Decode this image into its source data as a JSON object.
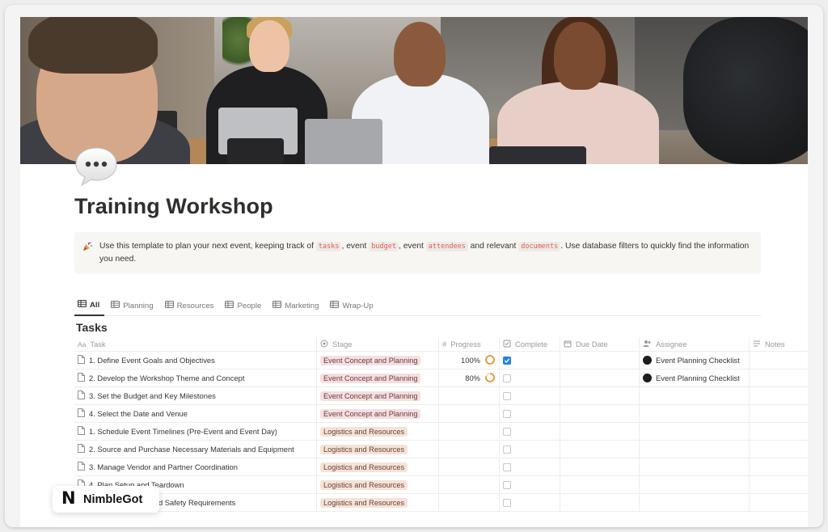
{
  "page": {
    "title": "Training Workshop"
  },
  "callout": {
    "before_tasks": "Use this template to plan your next event, keeping track of ",
    "tasks": "tasks",
    "between_1": ", event ",
    "budget": "budget",
    "between_2": ", event ",
    "attendees": "attendees",
    "between_3": " and relevant ",
    "documents": "documents",
    "after": ". Use database filters to quickly find the information you need."
  },
  "tabs": [
    {
      "label": "All",
      "active": true
    },
    {
      "label": "Planning"
    },
    {
      "label": "Resources"
    },
    {
      "label": "People"
    },
    {
      "label": "Marketing"
    },
    {
      "label": "Wrap-Up"
    }
  ],
  "database": {
    "title": "Tasks",
    "headers": {
      "task_icon": "Aa",
      "task": "Task",
      "stage": "Stage",
      "progress_icon": "#",
      "progress": "Progress",
      "complete": "Complete",
      "due": "Due Date",
      "assignee": "Assignee",
      "notes": "Notes"
    },
    "rows": [
      {
        "task": "1. Define Event Goals and Objectives",
        "stage": "Event Concept and Planning",
        "stage_color": "pink",
        "progress": "100%",
        "progress_value": 1.0,
        "complete": true,
        "assignee": "Event Planning Checklist"
      },
      {
        "task": "2. Develop the Workshop Theme and Concept",
        "stage": "Event Concept and Planning",
        "stage_color": "pink",
        "progress": "80%",
        "progress_value": 0.8,
        "complete": false,
        "assignee": "Event Planning Checklist"
      },
      {
        "task": "3. Set the Budget and Key Milestones",
        "stage": "Event Concept and Planning",
        "stage_color": "pink",
        "progress": "",
        "complete": false,
        "assignee": ""
      },
      {
        "task": "4. Select the Date and Venue",
        "stage": "Event Concept and Planning",
        "stage_color": "pink",
        "progress": "",
        "complete": false,
        "assignee": ""
      },
      {
        "task": "1. Schedule Event Timelines (Pre-Event and Event Day)",
        "stage": "Logistics and Resources",
        "stage_color": "peach",
        "progress": "",
        "complete": false,
        "assignee": ""
      },
      {
        "task": "2. Source and Purchase Necessary Materials and Equipment",
        "stage": "Logistics and Resources",
        "stage_color": "peach",
        "progress": "",
        "complete": false,
        "assignee": ""
      },
      {
        "task": "3. Manage Vendor and Partner Coordination",
        "stage": "Logistics and Resources",
        "stage_color": "peach",
        "progress": "",
        "complete": false,
        "assignee": ""
      },
      {
        "task": "4. Plan Setup and Teardown",
        "stage": "Logistics and Resources",
        "stage_color": "peach",
        "progress": "",
        "complete": false,
        "assignee": ""
      },
      {
        "task": "5. Confirm Health and Safety Requirements",
        "stage": "Logistics and Resources",
        "stage_color": "peach",
        "progress": "",
        "complete": false,
        "assignee": ""
      }
    ]
  },
  "watermark": {
    "letter": "N",
    "text": "NimbleGot"
  },
  "colors": {
    "accent_blue": "#2383e2",
    "progress_orange": "#e5953a",
    "code_red": "#eb5757",
    "tag_pink": "#f5dfe0",
    "tag_peach": "#f5e2d8"
  },
  "icons": {
    "page_icon": "speech-bubble-icon",
    "callout_icon": "party-popper-icon",
    "tab_icon": "table-icon",
    "row_icon": "document-icon"
  }
}
